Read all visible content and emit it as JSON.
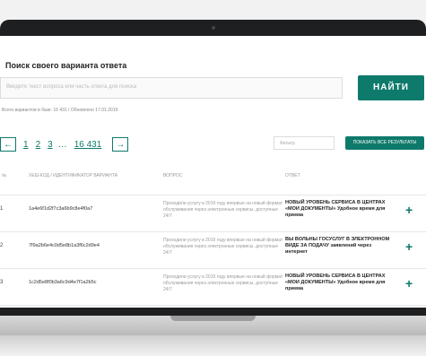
{
  "search": {
    "title": "Поиск своего варианта ответа",
    "placeholder": "Введите текст вопроса или часть ответа для поиска",
    "button_label": "НАЙТИ",
    "hint": "Всего вариантов в базе: 16 431 / Обновлено 17.01.2019"
  },
  "pagination": {
    "prev": "←",
    "pages": [
      "1",
      "2",
      "3"
    ],
    "ellipsis": "…",
    "last": "16 431",
    "next": "→"
  },
  "filter": {
    "placeholder": "Фильтр"
  },
  "show_all_label": "ПОКАЗАТЬ ВСЕ РЕЗУЛЬТАТЫ",
  "table": {
    "headers": [
      "№",
      "ХЕШ-КОД / ИДЕНТИФИКАТОР ВАРИАНТА",
      "ВОПРОС",
      "ОТВЕТ"
    ],
    "rows": [
      {
        "num": "1",
        "code": "1a4e6f1d2f7c3a6b9c8e4f0a7",
        "question": "Проходили услугу в 2019 году впервые на новый формат обслуживания через электронные сервисы, доступные 24/7",
        "answer": "НОВЫЙ УРОВЕНЬ СЕРВИСА В ЦЕНТРАХ «МОИ ДОКУМЕНТЫ» Удобное время для приема"
      },
      {
        "num": "2",
        "code": "7f9a2b6e4c0d5e8b1a3f6c2d9e4",
        "question": "Проходили услугу в 2019 году впервые на новый формат обслуживания через электронные сервисы, доступные 24/7",
        "answer": "ВЫ ВОЛЬНЫ ГОСУСЛУГ В ЭЛЕКТРОННОМ ВИДЕ ЗА ПОДАЧУ заявлений через интернет"
      },
      {
        "num": "3",
        "code": "1c2d5e8f0b3a6c9d4e7f1a2b5c",
        "question": "Проходили услугу в 2019 году впервые на новый формат обслуживания через электронные сервисы, доступные 24/7",
        "answer": "НОВЫЙ УРОВЕНЬ СЕРВИСА В ЦЕНТРАХ «МОИ ДОКУМЕНТЫ» Удобное время для приема"
      }
    ]
  },
  "colors": {
    "accent": "#0e7a6c",
    "bezel": "#1e1f21"
  }
}
